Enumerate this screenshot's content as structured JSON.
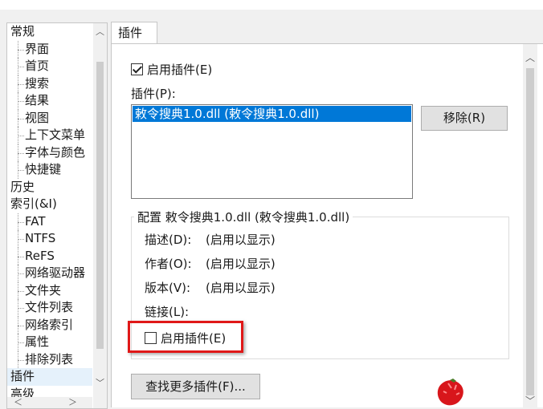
{
  "tree": {
    "items": [
      {
        "label": "常规",
        "level": 0
      },
      {
        "label": "界面",
        "level": 1
      },
      {
        "label": "首页",
        "level": 1
      },
      {
        "label": "搜索",
        "level": 1
      },
      {
        "label": "结果",
        "level": 1
      },
      {
        "label": "视图",
        "level": 1
      },
      {
        "label": "上下文菜单",
        "level": 1
      },
      {
        "label": "字体与颜色",
        "level": 1
      },
      {
        "label": "快捷键",
        "level": 1
      },
      {
        "label": "历史",
        "level": 0
      },
      {
        "label": "索引(&I)",
        "level": 0
      },
      {
        "label": "FAT",
        "level": 1
      },
      {
        "label": "NTFS",
        "level": 1
      },
      {
        "label": "ReFS",
        "level": 1
      },
      {
        "label": "网络驱动器",
        "level": 1
      },
      {
        "label": "文件夹",
        "level": 1
      },
      {
        "label": "文件列表",
        "level": 1
      },
      {
        "label": "网络索引",
        "level": 1
      },
      {
        "label": "属性",
        "level": 1
      },
      {
        "label": "排除列表",
        "level": 1
      },
      {
        "label": "插件",
        "level": 0,
        "selected": true
      },
      {
        "label": "高级",
        "level": 0
      }
    ]
  },
  "tab": {
    "label": "插件"
  },
  "panel": {
    "enable_label": "启用插件(E)",
    "enable_checked": true,
    "plugins_label": "插件(P):",
    "plugins": [
      "敕令搜典1.0.dll (敕令搜典1.0.dll)"
    ],
    "remove_button": "移除(R)",
    "group_title": "配置 敕令搜典1.0.dll (敕令搜典1.0.dll)",
    "desc_label": "描述(D):",
    "desc_value": "(启用以显示)",
    "author_label": "作者(O):",
    "author_value": "(启用以显示)",
    "version_label": "版本(V):",
    "version_value": "(启用以显示)",
    "link_label": "链接(L):",
    "plugin_enable_label": "启用插件(E)",
    "plugin_enable_checked": false,
    "find_more_button": "查找更多插件(F)..."
  },
  "colors": {
    "selection": "#0078d7",
    "annotation": "#e01818"
  }
}
